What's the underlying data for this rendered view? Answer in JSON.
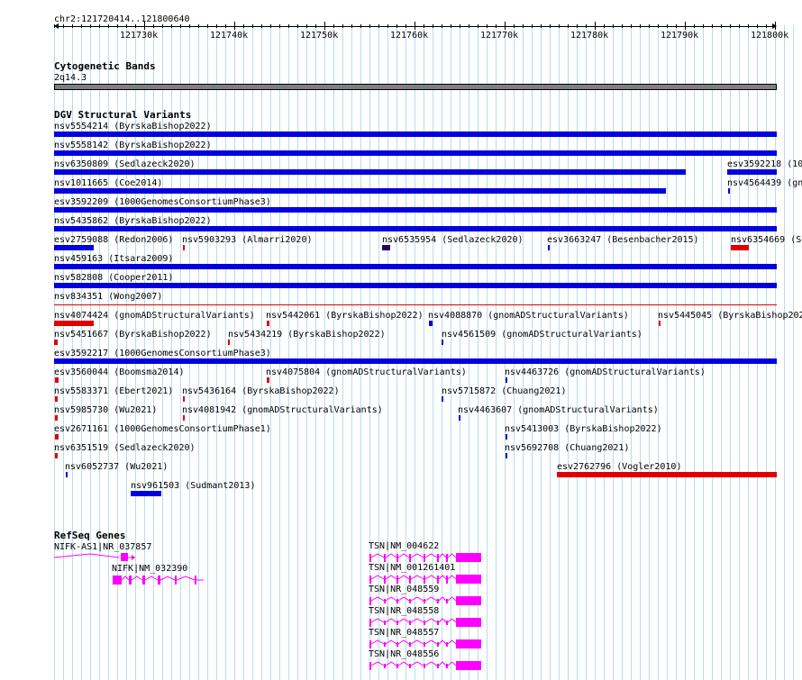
{
  "ruler": {
    "locus": "chr2:121720414..121800640",
    "ticks": [
      "121730k",
      "121740k",
      "121750k",
      "121760k",
      "121770k",
      "121780k",
      "121790k",
      "121800k"
    ]
  },
  "cytoband": {
    "title": "Cytogenetic Bands",
    "band": "2q14.3"
  },
  "dgv": {
    "title": "DGV Structural Variants",
    "variants": [
      {
        "id": "nsv5554214 (ByrskaBishop2022)",
        "color": "#0000e0"
      },
      {
        "id": "nsv5558142 (ByrskaBishop2022)",
        "color": "#0000e0"
      },
      {
        "id": "nsv6350809 (Sedlazeck2020)",
        "color": "#0000e0"
      },
      {
        "id": "esv3592218 (10",
        "color": "#0000e0"
      },
      {
        "id": "nsv1011665 (Coe2014)",
        "color": "#0000e0"
      },
      {
        "id": "nsv4564439 (gn",
        "color": "#0000e0"
      },
      {
        "id": "esv3592209 (1000GenomesConsortiumPhase3)",
        "color": "#0000e0"
      },
      {
        "id": "nsv5435862 (ByrskaBishop2022)",
        "color": "#0000e0"
      },
      {
        "id": "esv2759088 (Redon2006)",
        "color": "#0000e0"
      },
      {
        "id": "nsv5903293 (Almarri2020)",
        "color": "#e00000"
      },
      {
        "id": "nsv6535954 (Sedlazeck2020)",
        "color": "#2a0066"
      },
      {
        "id": "esv3663247 (Besenbacher2015)",
        "color": "#0000e0"
      },
      {
        "id": "nsv6354669 (Se",
        "color": "#e00000"
      },
      {
        "id": "nsv459163 (Itsara2009)",
        "color": "#0000e0"
      },
      {
        "id": "nsv582808 (Cooper2011)",
        "color": "#0000e0"
      },
      {
        "id": "nsv834351 (Wong2007)",
        "color": "#e00000"
      },
      {
        "id": "nsv4074424 (gnomADStructuralVariants)",
        "color": "#e00000"
      },
      {
        "id": "nsv5442061 (ByrskaBishop2022)",
        "color": "#e00000"
      },
      {
        "id": "nsv4088870 (gnomADStructuralVariants)",
        "color": "#0000e0"
      },
      {
        "id": "nsv5445045 (ByrskaBishop202",
        "color": "#e00000"
      },
      {
        "id": "nsv5451667 (ByrskaBishop2022)",
        "color": "#e00000"
      },
      {
        "id": "nsv5434219 (ByrskaBishop2022)",
        "color": "#e00000"
      },
      {
        "id": "nsv4561509 (gnomADStructuralVariants)",
        "color": "#0000e0"
      },
      {
        "id": "esv3592217 (1000GenomesConsortiumPhase3)",
        "color": "#0000e0"
      },
      {
        "id": "esv3560044 (Boomsma2014)",
        "color": "#e00000"
      },
      {
        "id": "nsv4075804 (gnomADStructuralVariants)",
        "color": "#e00000"
      },
      {
        "id": "nsv4463726 (gnomADStructuralVariants)",
        "color": "#0000e0"
      },
      {
        "id": "nsv5583371 (Ebert2021)",
        "color": "#e00000"
      },
      {
        "id": "nsv5436164 (ByrskaBishop2022)",
        "color": "#e00000"
      },
      {
        "id": "nsv5715872 (Chuang2021)",
        "color": "#0000e0"
      },
      {
        "id": "nsv5985730 (Wu2021)",
        "color": "#e00000"
      },
      {
        "id": "nsv4081942 (gnomADStructuralVariants)",
        "color": "#e00000"
      },
      {
        "id": "nsv4463607 (gnomADStructuralVariants)",
        "color": "#0000e0"
      },
      {
        "id": "esv2671161 (1000GenomesConsortiumPhase1)",
        "color": "#e00000"
      },
      {
        "id": "nsv5413003 (ByrskaBishop2022)",
        "color": "#0000e0"
      },
      {
        "id": "nsv6351519 (Sedlazeck2020)",
        "color": "#e00000"
      },
      {
        "id": "nsv5692708 (Chuang2021)",
        "color": "#0000e0"
      },
      {
        "id": "nsv6052737 (Wu2021)",
        "color": "#0000e0"
      },
      {
        "id": "esv2762796 (Vogler2010)",
        "color": "#e00000"
      },
      {
        "id": "nsv961503 (Sudmant2013)",
        "color": "#0000e0"
      }
    ]
  },
  "refseq": {
    "title": "RefSeq Genes",
    "genes": [
      "NIFK-AS1|NR_037857",
      "NIFK|NM_032390",
      "TSN|NM_004622",
      "TSN|NM_001261401",
      "TSN|NR_048559",
      "TSN|NR_048558",
      "TSN|NR_048557",
      "TSN|NR_048556"
    ],
    "gene_color": "#ff00ff"
  }
}
